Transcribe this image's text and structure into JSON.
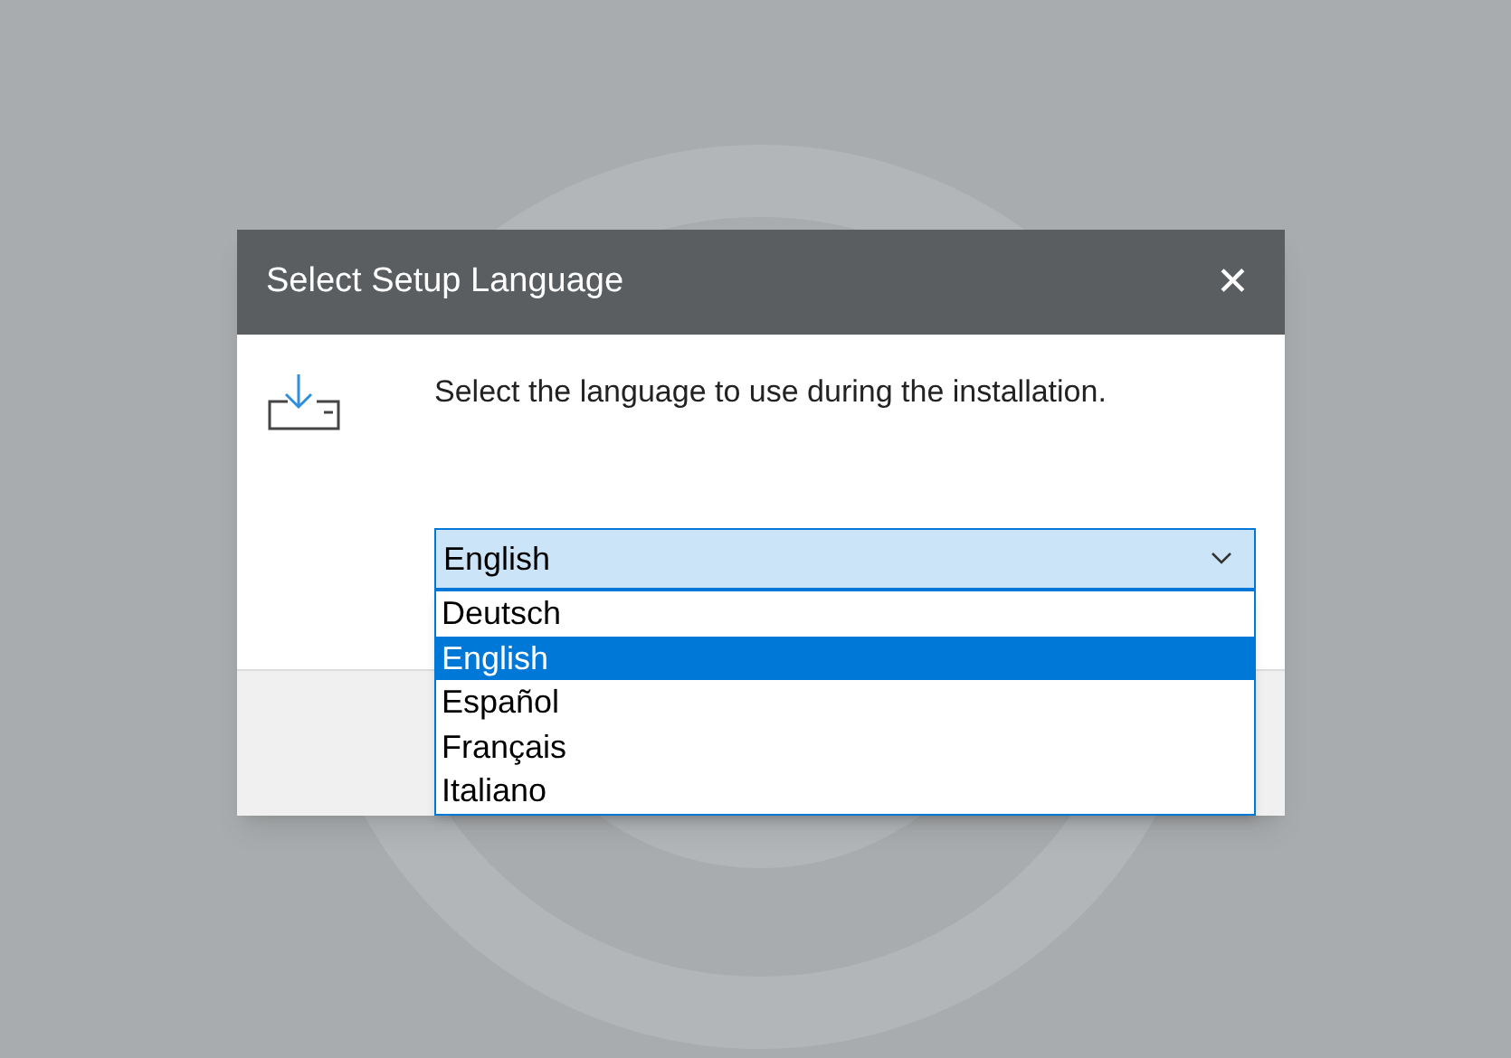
{
  "window": {
    "title": "Select Setup Language",
    "close_glyph": "✕"
  },
  "prompt": "Select the language to use during the installation.",
  "language_select": {
    "value": "English",
    "expanded": true,
    "options": [
      {
        "label": "Deutsch",
        "selected": false
      },
      {
        "label": "English",
        "selected": true
      },
      {
        "label": "Español",
        "selected": false
      },
      {
        "label": "Français",
        "selected": false
      },
      {
        "label": "Italiano",
        "selected": false
      }
    ]
  }
}
